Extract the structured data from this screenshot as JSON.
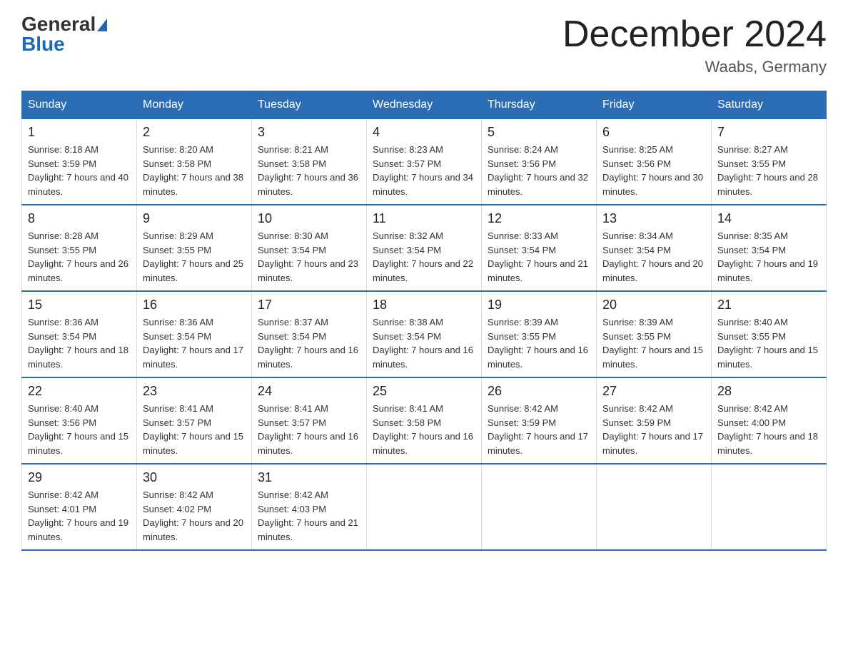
{
  "header": {
    "logo_general": "General",
    "logo_blue": "Blue",
    "month_title": "December 2024",
    "location": "Waabs, Germany"
  },
  "days_of_week": [
    "Sunday",
    "Monday",
    "Tuesday",
    "Wednesday",
    "Thursday",
    "Friday",
    "Saturday"
  ],
  "weeks": [
    [
      {
        "day": "1",
        "sunrise": "8:18 AM",
        "sunset": "3:59 PM",
        "daylight": "7 hours and 40 minutes."
      },
      {
        "day": "2",
        "sunrise": "8:20 AM",
        "sunset": "3:58 PM",
        "daylight": "7 hours and 38 minutes."
      },
      {
        "day": "3",
        "sunrise": "8:21 AM",
        "sunset": "3:58 PM",
        "daylight": "7 hours and 36 minutes."
      },
      {
        "day": "4",
        "sunrise": "8:23 AM",
        "sunset": "3:57 PM",
        "daylight": "7 hours and 34 minutes."
      },
      {
        "day": "5",
        "sunrise": "8:24 AM",
        "sunset": "3:56 PM",
        "daylight": "7 hours and 32 minutes."
      },
      {
        "day": "6",
        "sunrise": "8:25 AM",
        "sunset": "3:56 PM",
        "daylight": "7 hours and 30 minutes."
      },
      {
        "day": "7",
        "sunrise": "8:27 AM",
        "sunset": "3:55 PM",
        "daylight": "7 hours and 28 minutes."
      }
    ],
    [
      {
        "day": "8",
        "sunrise": "8:28 AM",
        "sunset": "3:55 PM",
        "daylight": "7 hours and 26 minutes."
      },
      {
        "day": "9",
        "sunrise": "8:29 AM",
        "sunset": "3:55 PM",
        "daylight": "7 hours and 25 minutes."
      },
      {
        "day": "10",
        "sunrise": "8:30 AM",
        "sunset": "3:54 PM",
        "daylight": "7 hours and 23 minutes."
      },
      {
        "day": "11",
        "sunrise": "8:32 AM",
        "sunset": "3:54 PM",
        "daylight": "7 hours and 22 minutes."
      },
      {
        "day": "12",
        "sunrise": "8:33 AM",
        "sunset": "3:54 PM",
        "daylight": "7 hours and 21 minutes."
      },
      {
        "day": "13",
        "sunrise": "8:34 AM",
        "sunset": "3:54 PM",
        "daylight": "7 hours and 20 minutes."
      },
      {
        "day": "14",
        "sunrise": "8:35 AM",
        "sunset": "3:54 PM",
        "daylight": "7 hours and 19 minutes."
      }
    ],
    [
      {
        "day": "15",
        "sunrise": "8:36 AM",
        "sunset": "3:54 PM",
        "daylight": "7 hours and 18 minutes."
      },
      {
        "day": "16",
        "sunrise": "8:36 AM",
        "sunset": "3:54 PM",
        "daylight": "7 hours and 17 minutes."
      },
      {
        "day": "17",
        "sunrise": "8:37 AM",
        "sunset": "3:54 PM",
        "daylight": "7 hours and 16 minutes."
      },
      {
        "day": "18",
        "sunrise": "8:38 AM",
        "sunset": "3:54 PM",
        "daylight": "7 hours and 16 minutes."
      },
      {
        "day": "19",
        "sunrise": "8:39 AM",
        "sunset": "3:55 PM",
        "daylight": "7 hours and 16 minutes."
      },
      {
        "day": "20",
        "sunrise": "8:39 AM",
        "sunset": "3:55 PM",
        "daylight": "7 hours and 15 minutes."
      },
      {
        "day": "21",
        "sunrise": "8:40 AM",
        "sunset": "3:55 PM",
        "daylight": "7 hours and 15 minutes."
      }
    ],
    [
      {
        "day": "22",
        "sunrise": "8:40 AM",
        "sunset": "3:56 PM",
        "daylight": "7 hours and 15 minutes."
      },
      {
        "day": "23",
        "sunrise": "8:41 AM",
        "sunset": "3:57 PM",
        "daylight": "7 hours and 15 minutes."
      },
      {
        "day": "24",
        "sunrise": "8:41 AM",
        "sunset": "3:57 PM",
        "daylight": "7 hours and 16 minutes."
      },
      {
        "day": "25",
        "sunrise": "8:41 AM",
        "sunset": "3:58 PM",
        "daylight": "7 hours and 16 minutes."
      },
      {
        "day": "26",
        "sunrise": "8:42 AM",
        "sunset": "3:59 PM",
        "daylight": "7 hours and 17 minutes."
      },
      {
        "day": "27",
        "sunrise": "8:42 AM",
        "sunset": "3:59 PM",
        "daylight": "7 hours and 17 minutes."
      },
      {
        "day": "28",
        "sunrise": "8:42 AM",
        "sunset": "4:00 PM",
        "daylight": "7 hours and 18 minutes."
      }
    ],
    [
      {
        "day": "29",
        "sunrise": "8:42 AM",
        "sunset": "4:01 PM",
        "daylight": "7 hours and 19 minutes."
      },
      {
        "day": "30",
        "sunrise": "8:42 AM",
        "sunset": "4:02 PM",
        "daylight": "7 hours and 20 minutes."
      },
      {
        "day": "31",
        "sunrise": "8:42 AM",
        "sunset": "4:03 PM",
        "daylight": "7 hours and 21 minutes."
      },
      null,
      null,
      null,
      null
    ]
  ]
}
